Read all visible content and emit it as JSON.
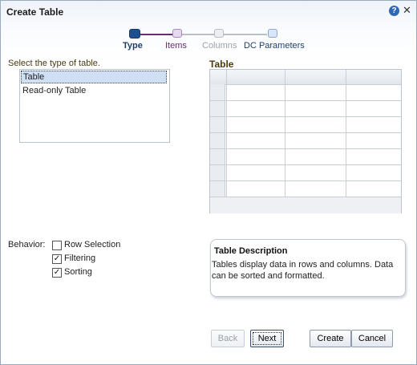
{
  "dialog": {
    "title": "Create Table"
  },
  "train": {
    "stops": [
      {
        "label": "Type",
        "state": "current"
      },
      {
        "label": "Items",
        "state": "visited"
      },
      {
        "label": "Columns",
        "state": "disabled"
      },
      {
        "label": "DC Parameters",
        "state": "enabled"
      }
    ]
  },
  "type_select": {
    "label": "Select the type of table.",
    "items": [
      "Table",
      "Read-only Table"
    ],
    "selected": "Table"
  },
  "preview": {
    "title": "Table"
  },
  "behavior": {
    "label": "Behavior:",
    "options": [
      {
        "label": "Row Selection",
        "checked": false
      },
      {
        "label": "Filtering",
        "checked": true
      },
      {
        "label": "Sorting",
        "checked": true
      }
    ]
  },
  "description": {
    "title": "Table Description",
    "text": "Tables display data in rows and columns. Data can be sorted and formatted."
  },
  "buttons": {
    "back": "Back",
    "next": "Next",
    "create": "Create",
    "cancel": "Cancel"
  },
  "colors": {
    "train_current": "#1f4f8c",
    "train_visited": "#6b2c7a",
    "train_disabled": "#9aa3ae",
    "train_enabled": "#1f3f6a"
  }
}
